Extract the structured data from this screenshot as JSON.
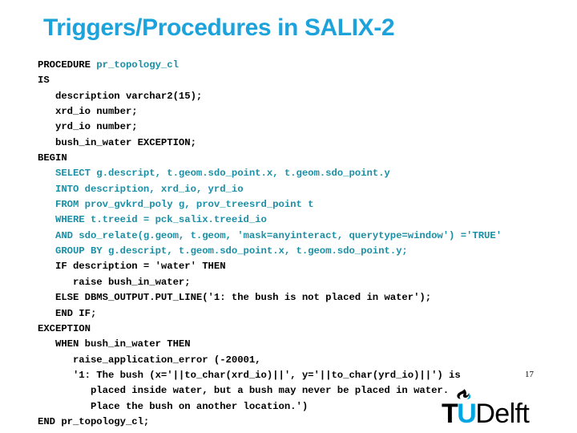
{
  "slide": {
    "title": "Triggers/Procedures in SALIX-2",
    "title_color": "#1ca3db",
    "page_number": "17",
    "background_color": "#ffffff"
  },
  "code": {
    "keyword_color": "#000000",
    "highlight_color": "#1a8fa6",
    "lines": [
      {
        "indent": 0,
        "color": "black",
        "text": "PROCEDURE ",
        "text2": "pr_topology_cl",
        "color2": "teal"
      },
      {
        "indent": 0,
        "color": "black",
        "text": "IS"
      },
      {
        "indent": 1,
        "color": "black",
        "text": "description varchar2(15);"
      },
      {
        "indent": 1,
        "color": "black",
        "text": "xrd_io number;"
      },
      {
        "indent": 1,
        "color": "black",
        "text": "yrd_io number;"
      },
      {
        "indent": 1,
        "color": "black",
        "text": "bush_in_water EXCEPTION;"
      },
      {
        "indent": 0,
        "color": "black",
        "text": "BEGIN"
      },
      {
        "indent": 1,
        "color": "teal",
        "text": "SELECT g.descript, t.geom.sdo_point.x, t.geom.sdo_point.y"
      },
      {
        "indent": 1,
        "color": "teal",
        "text": "INTO description, xrd_io, yrd_io"
      },
      {
        "indent": 1,
        "color": "teal",
        "text": "FROM prov_gvkrd_poly g, prov_treesrd_point t"
      },
      {
        "indent": 1,
        "color": "teal",
        "text": "WHERE t.treeid = pck_salix.treeid_io"
      },
      {
        "indent": 1,
        "color": "teal",
        "text": "AND sdo_relate(g.geom, t.geom, 'mask=anyinteract, querytype=window') ='TRUE'"
      },
      {
        "indent": 1,
        "color": "teal",
        "text": "GROUP BY g.descript, t.geom.sdo_point.x, t.geom.sdo_point.y;"
      },
      {
        "indent": 1,
        "color": "black",
        "text": "IF description = 'water' THEN"
      },
      {
        "indent": 2,
        "color": "black",
        "text": "raise bush_in_water;"
      },
      {
        "indent": 1,
        "color": "black",
        "text": "ELSE DBMS_OUTPUT.PUT_LINE('1: the bush is not placed in water');"
      },
      {
        "indent": 1,
        "color": "black",
        "text": "END IF;"
      },
      {
        "indent": 0,
        "color": "black",
        "text": "EXCEPTION"
      },
      {
        "indent": 1,
        "color": "black",
        "text": "WHEN bush_in_water THEN"
      },
      {
        "indent": 2,
        "color": "black",
        "text": "raise_application_error (-20001,"
      },
      {
        "indent": 2,
        "color": "black",
        "text": "'1: The bush (x='||to_char(xrd_io)||', y='||to_char(yrd_io)||') is"
      },
      {
        "indent": 3,
        "color": "black",
        "text": "placed inside water, but a bush may never be placed in water."
      },
      {
        "indent": 3,
        "color": "black",
        "text": "Place the bush on another location.')"
      },
      {
        "indent": 0,
        "color": "black",
        "text": "END pr_topology_cl;"
      }
    ]
  },
  "logo": {
    "name": "TU Delft",
    "t": "T",
    "u": "U",
    "delft": "Delft",
    "u_color": "#00a6e2",
    "text_color": "#000000"
  }
}
